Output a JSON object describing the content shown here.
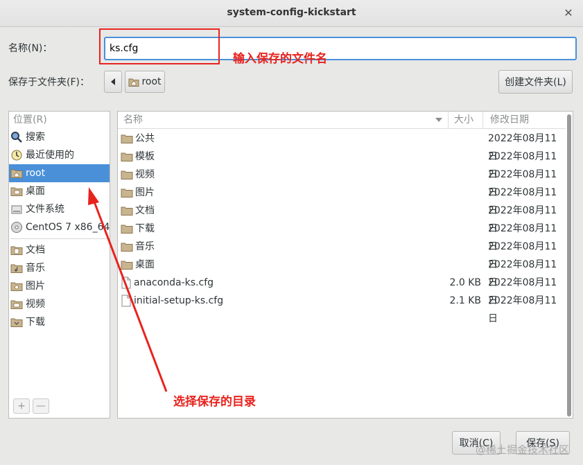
{
  "window": {
    "title": "system-config-kickstart"
  },
  "form": {
    "name_label": "名称(N)：",
    "name_value": "ks.cfg",
    "save_in_label": "保存于文件夹(F)：",
    "path_current": "root",
    "create_folder_label": "创建文件夹(L)"
  },
  "places": {
    "header": "位置(R)",
    "items": [
      {
        "label": "搜索",
        "icon": "search-icon"
      },
      {
        "label": "最近使用的",
        "icon": "recent-icon"
      },
      {
        "label": "root",
        "icon": "home-folder-icon",
        "selected": true
      },
      {
        "label": "桌面",
        "icon": "desktop-folder-icon"
      },
      {
        "label": "文件系统",
        "icon": "drive-icon"
      },
      {
        "label": "CentOS 7 x86_64",
        "icon": "disc-icon"
      }
    ],
    "bookmarks": [
      {
        "label": "文档",
        "icon": "documents-folder-icon"
      },
      {
        "label": "音乐",
        "icon": "music-folder-icon"
      },
      {
        "label": "图片",
        "icon": "pictures-folder-icon"
      },
      {
        "label": "视频",
        "icon": "videos-folder-icon"
      },
      {
        "label": "下载",
        "icon": "downloads-folder-icon"
      }
    ],
    "add_label": "+",
    "remove_label": "—"
  },
  "files": {
    "columns": {
      "name": "名称",
      "size": "大小",
      "modified": "修改日期"
    },
    "rows": [
      {
        "name": "公共",
        "size": "",
        "modified": "2022年08月11日",
        "type": "folder"
      },
      {
        "name": "模板",
        "size": "",
        "modified": "2022年08月11日",
        "type": "folder"
      },
      {
        "name": "视频",
        "size": "",
        "modified": "2022年08月11日",
        "type": "folder"
      },
      {
        "name": "图片",
        "size": "",
        "modified": "2022年08月11日",
        "type": "folder"
      },
      {
        "name": "文档",
        "size": "",
        "modified": "2022年08月11日",
        "type": "folder"
      },
      {
        "name": "下载",
        "size": "",
        "modified": "2022年08月11日",
        "type": "folder"
      },
      {
        "name": "音乐",
        "size": "",
        "modified": "2022年08月11日",
        "type": "folder"
      },
      {
        "name": "桌面",
        "size": "",
        "modified": "2022年08月11日",
        "type": "folder"
      },
      {
        "name": "anaconda-ks.cfg",
        "size": "2.0 KB",
        "modified": "2022年08月11日",
        "type": "file"
      },
      {
        "name": "initial-setup-ks.cfg",
        "size": "2.1 KB",
        "modified": "2022年08月11日",
        "type": "file"
      }
    ]
  },
  "buttons": {
    "cancel": "取消(C)",
    "save": "保存(S)"
  },
  "annotations": {
    "input_hint": "输入保存的文件名",
    "dir_hint": "选择保存的目录",
    "color": "#e8231e"
  },
  "watermark": "@稀土掘金技术社区",
  "colors": {
    "selection": "#4a90d9",
    "focus_border": "#4a90d9"
  }
}
